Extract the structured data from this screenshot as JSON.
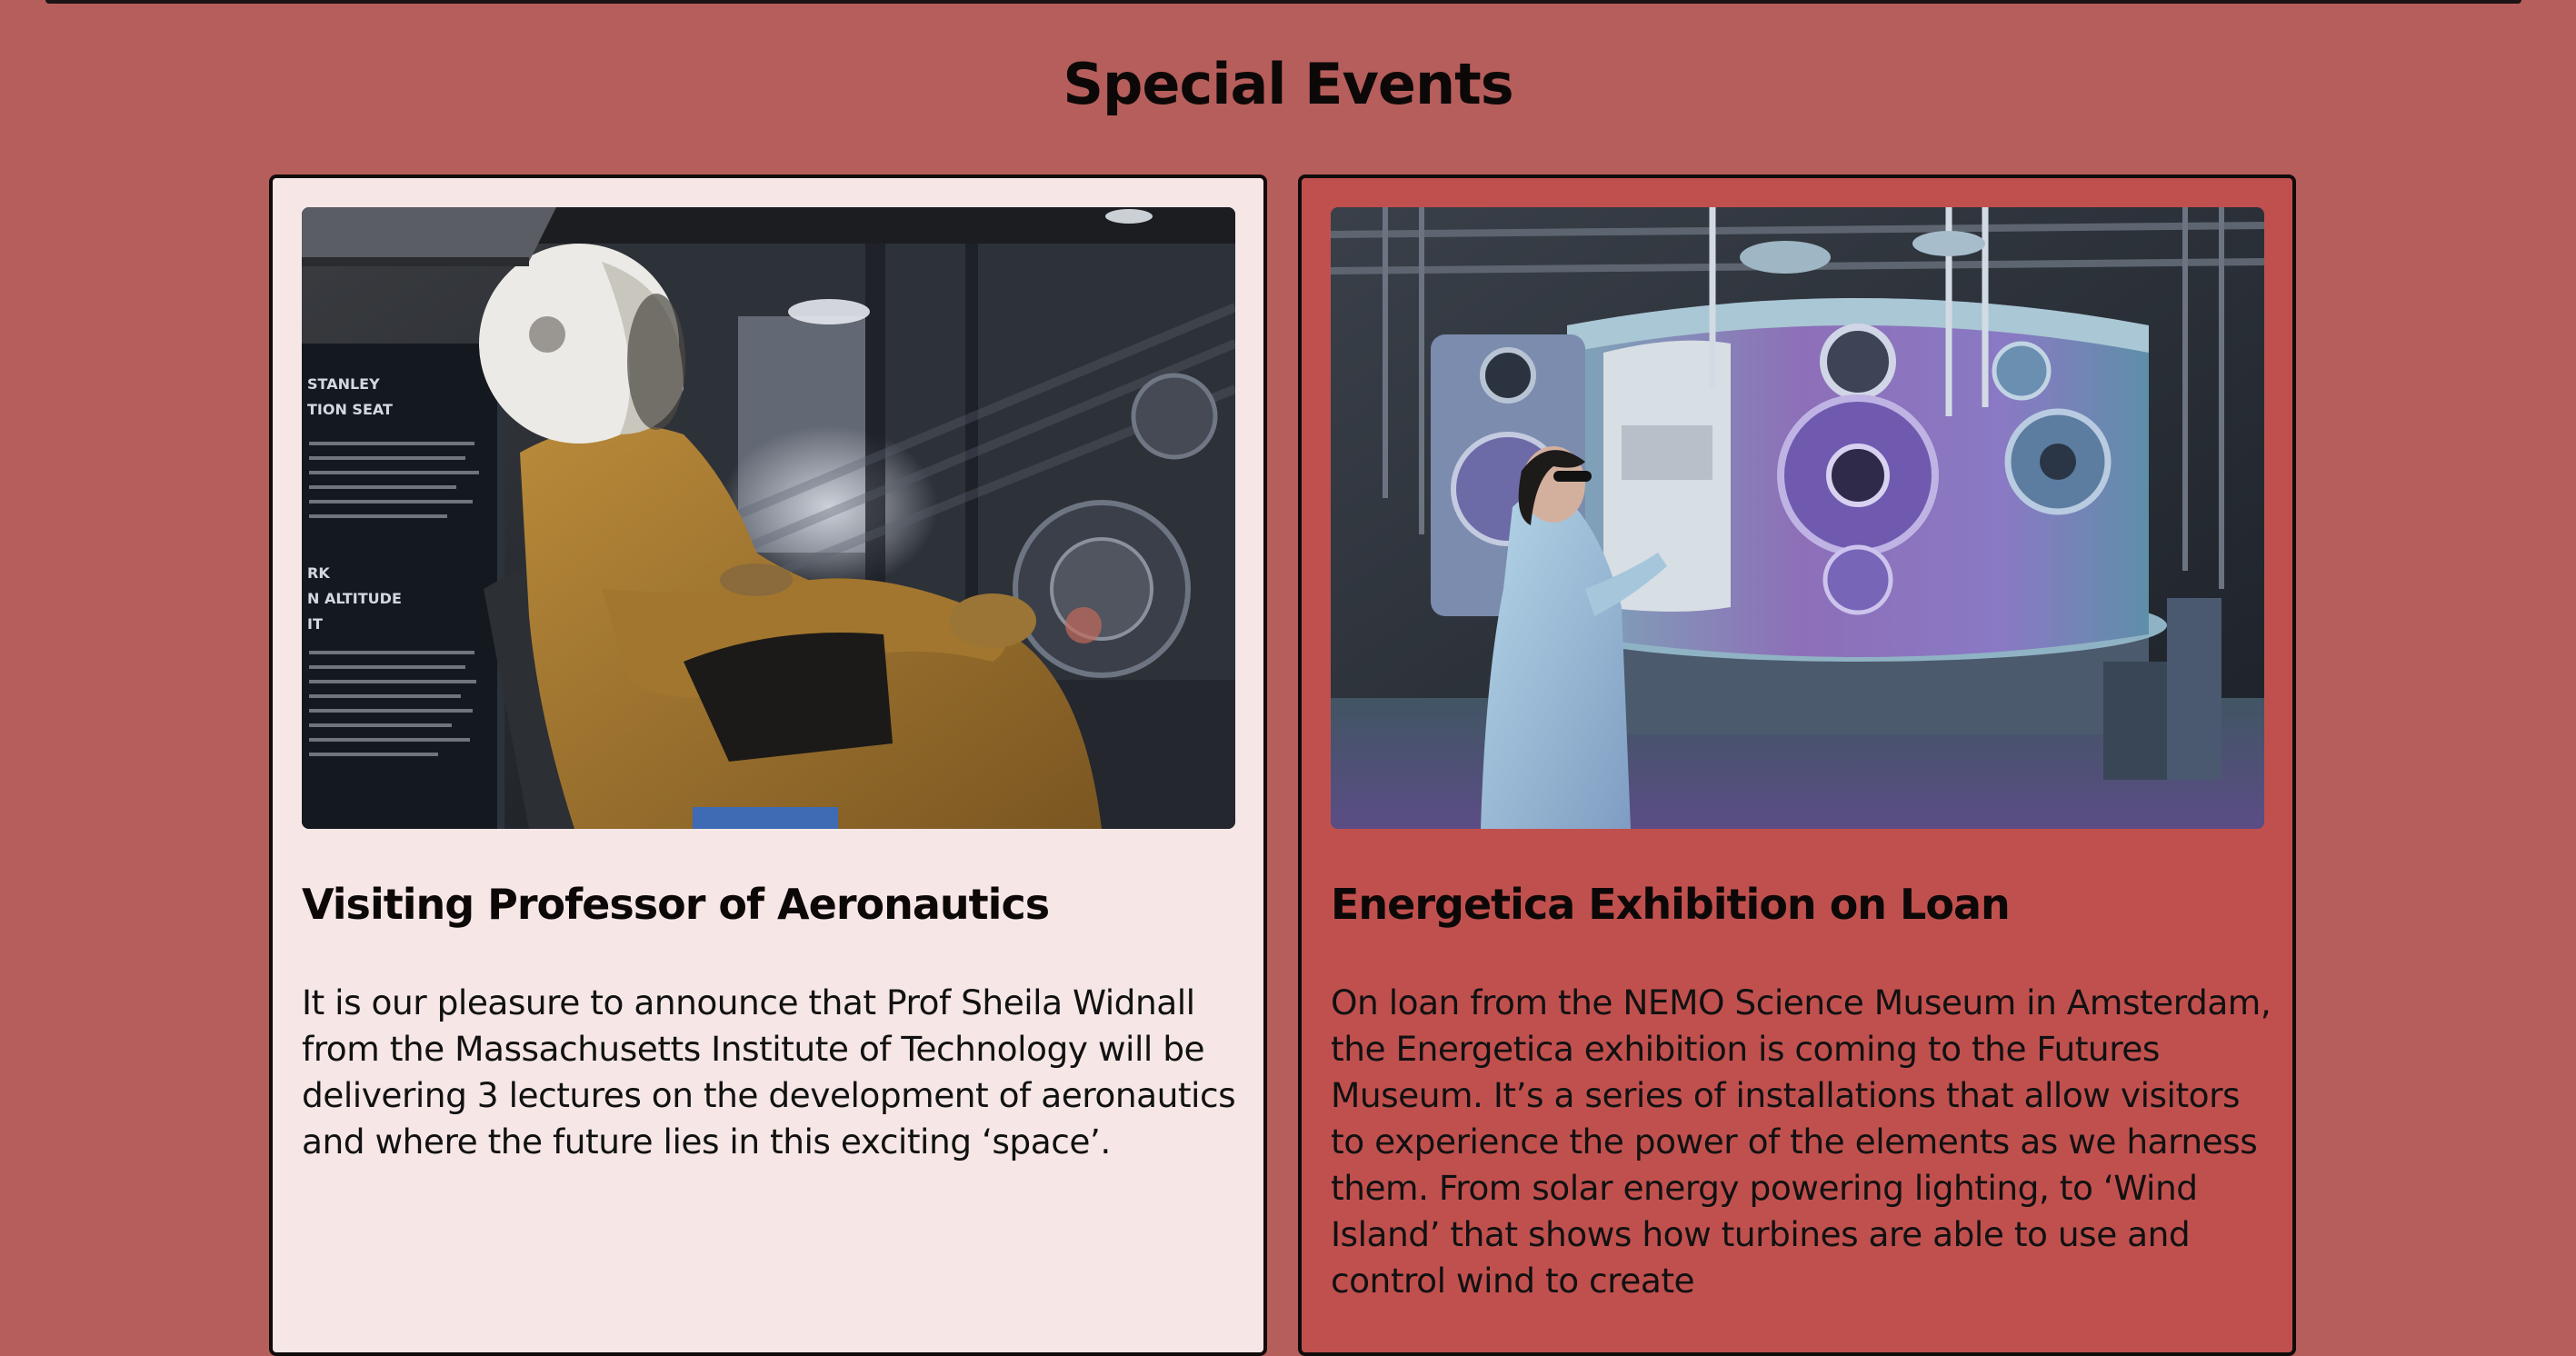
{
  "section": {
    "title": "Special Events"
  },
  "events": [
    {
      "title": "Visiting Professor of Aeronautics",
      "body": "It is our pleasure to announce that Prof Sheila Widnall from the Massachusetts Institute of Technology will be delivering 3 lectures on the development of aeronautics and where the future lies in this exciting ‘space’.",
      "image_sign": [
        "STANLEY",
        "TION SEAT",
        "RK",
        "N ALTITUDE",
        "IT"
      ]
    },
    {
      "title": "Energetica Exhibition on Loan",
      "body": "On loan from the NEMO Science Museum in Amsterdam, the Energetica exhibition is coming to the Futures Museum. It’s a series of installations that allow visitors to experience the power of the elements as we harness them. From solar energy powering lighting, to ‘Wind Island’ that shows how turbines are able to use and control wind to create"
    }
  ],
  "colors": {
    "page_background": "#b65e5c",
    "card_left_background": "#f6e6e6",
    "card_right_background": "#c0504e",
    "border": "#120b0b"
  }
}
